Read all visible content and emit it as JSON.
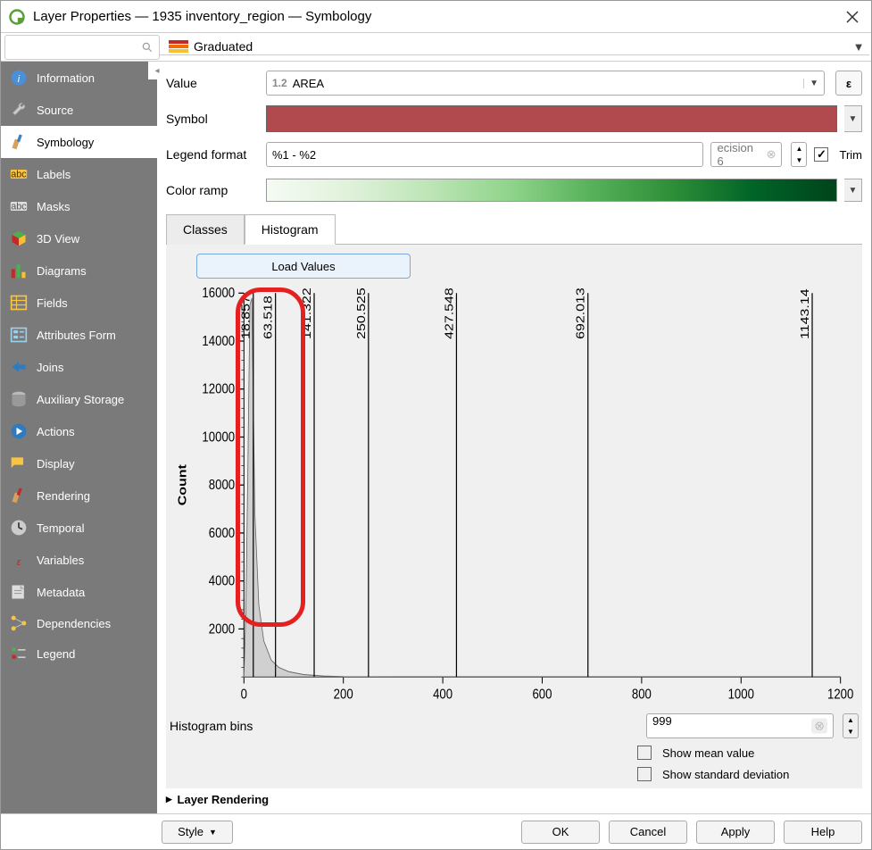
{
  "titlebar": {
    "title": "Layer Properties — 1935 inventory_region — Symbology"
  },
  "renderer": {
    "label": "Graduated"
  },
  "sidebar": {
    "items": [
      {
        "label": "Information"
      },
      {
        "label": "Source"
      },
      {
        "label": "Symbology"
      },
      {
        "label": "Labels"
      },
      {
        "label": "Masks"
      },
      {
        "label": "3D View"
      },
      {
        "label": "Diagrams"
      },
      {
        "label": "Fields"
      },
      {
        "label": "Attributes Form"
      },
      {
        "label": "Joins"
      },
      {
        "label": "Auxiliary Storage"
      },
      {
        "label": "Actions"
      },
      {
        "label": "Display"
      },
      {
        "label": "Rendering"
      },
      {
        "label": "Temporal"
      },
      {
        "label": "Variables"
      },
      {
        "label": "Metadata"
      },
      {
        "label": "Dependencies"
      },
      {
        "label": "Legend"
      }
    ]
  },
  "form": {
    "value_label": "Value",
    "value_field": "AREA",
    "symbol_label": "Symbol",
    "legend_format_label": "Legend format",
    "legend_format": "%1 - %2",
    "precision_label": "ecision 6",
    "trim_label": "Trim",
    "trim_checked": "✓",
    "color_ramp_label": "Color ramp"
  },
  "tabs": {
    "classes": "Classes",
    "histogram": "Histogram"
  },
  "histogram": {
    "load_values": "Load Values",
    "ylabel": "Count",
    "bins_label": "Histogram bins",
    "bins_value": "999",
    "show_mean": "Show mean value",
    "show_stddev": "Show standard deviation"
  },
  "layer_rendering": "Layer Rendering",
  "footer": {
    "style": "Style",
    "ok": "OK",
    "cancel": "Cancel",
    "apply": "Apply",
    "help": "Help"
  },
  "chart_data": {
    "type": "bar",
    "title": "",
    "xlabel": "",
    "ylabel": "Count",
    "xlim": [
      0,
      1200
    ],
    "ylim": [
      0,
      16000
    ],
    "x_ticks": [
      0,
      200,
      400,
      600,
      800,
      1000,
      1200
    ],
    "y_ticks": [
      2000,
      4000,
      6000,
      8000,
      10000,
      12000,
      14000,
      16000
    ],
    "class_breaks": [
      18.857,
      63.518,
      141.322,
      250.525,
      427.548,
      692.013,
      1143.14
    ],
    "histogram_profile": [
      {
        "x": 0,
        "count": 0
      },
      {
        "x": 4,
        "count": 2800
      },
      {
        "x": 8,
        "count": 8800
      },
      {
        "x": 12,
        "count": 15500
      },
      {
        "x": 16,
        "count": 15800
      },
      {
        "x": 22,
        "count": 6800
      },
      {
        "x": 30,
        "count": 3000
      },
      {
        "x": 40,
        "count": 1500
      },
      {
        "x": 55,
        "count": 700
      },
      {
        "x": 70,
        "count": 400
      },
      {
        "x": 90,
        "count": 220
      },
      {
        "x": 120,
        "count": 100
      },
      {
        "x": 160,
        "count": 40
      },
      {
        "x": 200,
        "count": 10
      },
      {
        "x": 300,
        "count": 0
      },
      {
        "x": 1200,
        "count": 0
      }
    ]
  }
}
